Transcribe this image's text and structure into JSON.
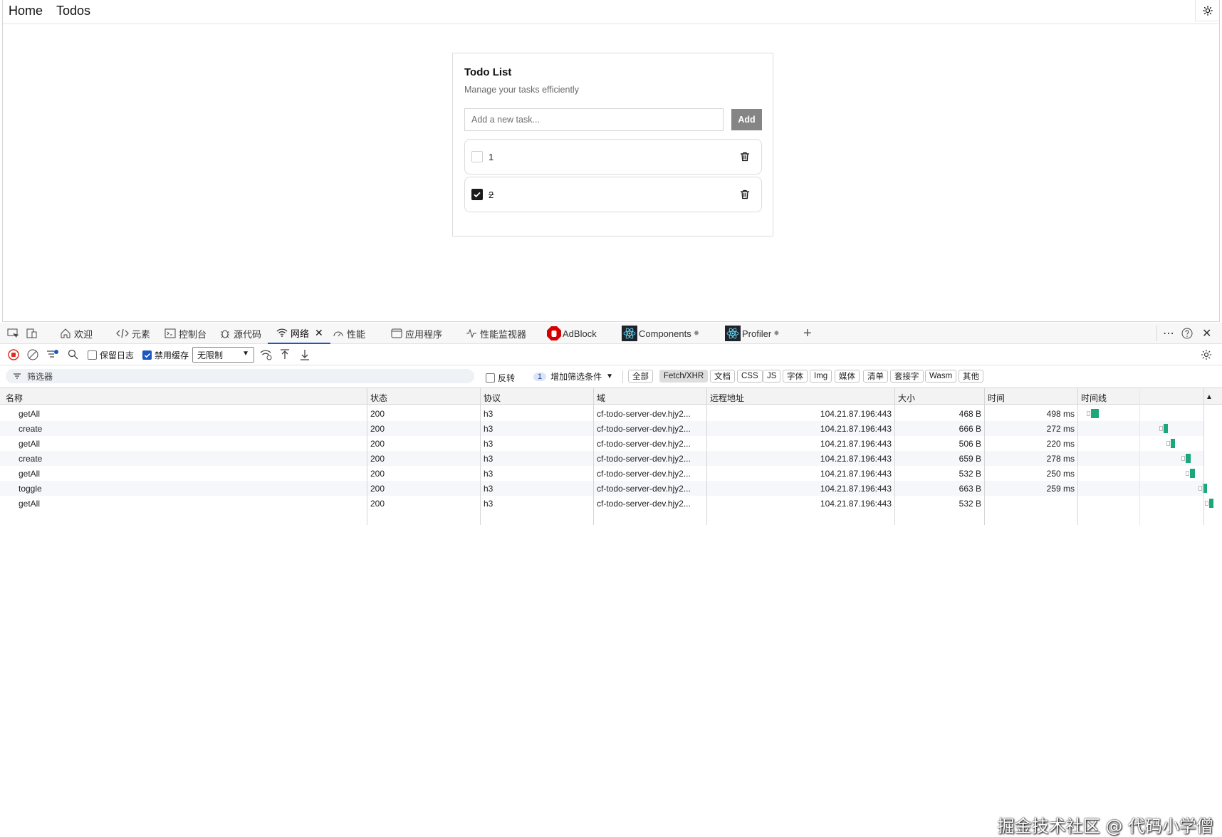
{
  "app": {
    "nav": {
      "home": "Home",
      "todos": "Todos"
    },
    "card": {
      "title": "Todo List",
      "subtitle": "Manage your tasks efficiently",
      "input_placeholder": "Add a new task...",
      "add_label": "Add",
      "items": [
        {
          "text": "1",
          "completed": false
        },
        {
          "text": "2",
          "completed": true
        }
      ]
    }
  },
  "devtools": {
    "tabs": {
      "welcome": "欢迎",
      "elements": "元素",
      "console": "控制台",
      "sources": "源代码",
      "network": "网络",
      "performance": "性能",
      "application": "应用程序",
      "perf_monitor": "性能监视器",
      "adblock": "AdBlock",
      "components": "Components",
      "profiler": "Profiler"
    },
    "toolbar": {
      "preserve_log": "保留日志",
      "disable_cache": "禁用缓存",
      "throttle": "无限制"
    },
    "filter": {
      "placeholder": "筛选器",
      "invert": "反转",
      "more_filters_count": "1",
      "more_filters": "增加筛选条件",
      "types": [
        "全部",
        "Fetch/XHR",
        "文档",
        "CSS",
        "JS",
        "字体",
        "Img",
        "媒体",
        "清单",
        "套接字",
        "Wasm",
        "其他"
      ],
      "selected_type": "Fetch/XHR"
    },
    "table": {
      "headers": {
        "name": "名称",
        "status": "状态",
        "protocol": "协议",
        "domain": "域",
        "remote": "远程地址",
        "size": "大小",
        "time": "时间",
        "waterfall": "时间线"
      },
      "rows": [
        {
          "name": "getAll",
          "status": "200",
          "protocol": "h3",
          "domain": "cf-todo-server-dev.hjy2...",
          "remote": "104.21.87.196:443",
          "size": "468 B",
          "time": "498 ms"
        },
        {
          "name": "create",
          "status": "200",
          "protocol": "h3",
          "domain": "cf-todo-server-dev.hjy2...",
          "remote": "104.21.87.196:443",
          "size": "666 B",
          "time": "272 ms"
        },
        {
          "name": "getAll",
          "status": "200",
          "protocol": "h3",
          "domain": "cf-todo-server-dev.hjy2...",
          "remote": "104.21.87.196:443",
          "size": "506 B",
          "time": "220 ms"
        },
        {
          "name": "create",
          "status": "200",
          "protocol": "h3",
          "domain": "cf-todo-server-dev.hjy2...",
          "remote": "104.21.87.196:443",
          "size": "659 B",
          "time": "278 ms"
        },
        {
          "name": "getAll",
          "status": "200",
          "protocol": "h3",
          "domain": "cf-todo-server-dev.hjy2...",
          "remote": "104.21.87.196:443",
          "size": "532 B",
          "time": "250 ms"
        },
        {
          "name": "toggle",
          "status": "200",
          "protocol": "h3",
          "domain": "cf-todo-server-dev.hjy2...",
          "remote": "104.21.87.196:443",
          "size": "663 B",
          "time": "259 ms"
        },
        {
          "name": "getAll",
          "status": "200",
          "protocol": "h3",
          "domain": "cf-todo-server-dev.hjy2...",
          "remote": "104.21.87.196:443",
          "size": "532 B",
          "time": ""
        }
      ]
    }
  },
  "watermark": "掘金技术社区 @ 代码小学僧",
  "colors": {
    "accent": "#1a57c2",
    "waterfall": "#1aa77a",
    "add_button": "#858585"
  }
}
